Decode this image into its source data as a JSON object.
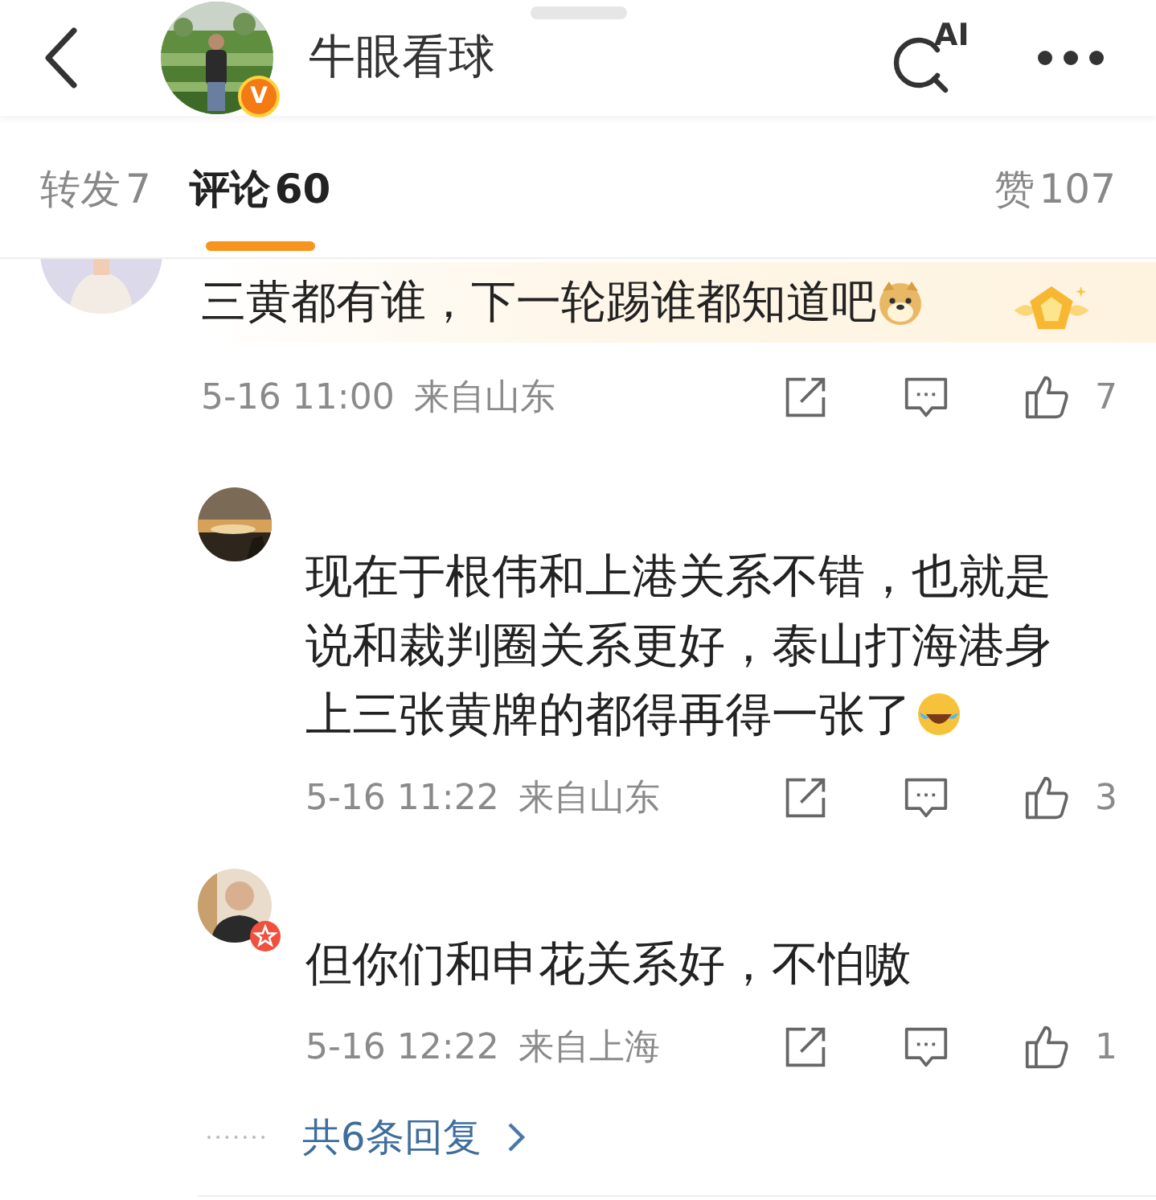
{
  "header": {
    "title": "牛眼看球",
    "badge": "V",
    "search_label": "AI"
  },
  "tabs": [
    {
      "label": "转发",
      "count": "7",
      "selected": false
    },
    {
      "label": "评论",
      "count": "60",
      "selected": true
    },
    {
      "label": "赞",
      "count": "107",
      "selected": false
    }
  ],
  "comment": {
    "text": "三黄都有谁，下一轮踢谁都知道吧",
    "emoji": {
      "kind": "doge"
    },
    "time": "5-16 11:00",
    "location": "来自山东",
    "likes": "7"
  },
  "replies": [
    {
      "text": "现在于根伟和上港关系不错，也就是说和裁判圈关系更好，泰山打海港身上三张黄牌的都得再得一张了",
      "emoji": {
        "kind": "laugh"
      },
      "time": "5-16 11:22",
      "location": "来自山东",
      "likes": "3"
    },
    {
      "avatar": {
        "kind": "silhouette"
      },
      "text": "但你们和申花关系好，不怕嗷",
      "time": "5-16 12:22",
      "location": "来自上海",
      "likes": "1"
    }
  ],
  "more_replies": "共6条回复"
}
